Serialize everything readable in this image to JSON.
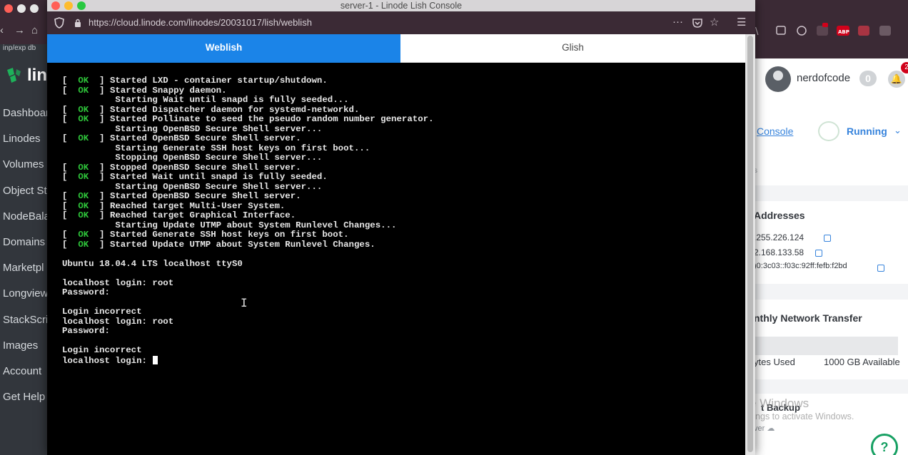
{
  "window": {
    "title": "server-1 - Linode Lish Console",
    "url": "https://cloud.linode.com/linodes/20031017/lish/weblish"
  },
  "tabs": [
    {
      "label": "Weblish",
      "active": true
    },
    {
      "label": "Glish",
      "active": false
    }
  ],
  "terminal": {
    "lines": [
      {
        "status": "OK",
        "text": "Started LXD - container startup/shutdown."
      },
      {
        "status": "OK",
        "text": "Started Snappy daemon."
      },
      {
        "status": "",
        "text": "Starting Wait until snapd is fully seeded..."
      },
      {
        "status": "OK",
        "text": "Started Dispatcher daemon for systemd-networkd."
      },
      {
        "status": "OK",
        "text": "Started Pollinate to seed the pseudo random number generator."
      },
      {
        "status": "",
        "text": "Starting OpenBSD Secure Shell server..."
      },
      {
        "status": "OK",
        "text": "Started OpenBSD Secure Shell server."
      },
      {
        "status": "",
        "text": "Starting Generate SSH host keys on first boot..."
      },
      {
        "status": "",
        "text": "Stopping OpenBSD Secure Shell server..."
      },
      {
        "status": "OK",
        "text": "Stopped OpenBSD Secure Shell server."
      },
      {
        "status": "OK",
        "text": "Started Wait until snapd is fully seeded."
      },
      {
        "status": "",
        "text": "Starting OpenBSD Secure Shell server..."
      },
      {
        "status": "OK",
        "text": "Started OpenBSD Secure Shell server."
      },
      {
        "status": "OK",
        "text": "Reached target Multi-User System."
      },
      {
        "status": "OK",
        "text": "Reached target Graphical Interface."
      },
      {
        "status": "",
        "text": "Starting Update UTMP about System Runlevel Changes..."
      },
      {
        "status": "OK",
        "text": "Started Generate SSH host keys on first boot."
      },
      {
        "status": "OK",
        "text": "Started Update UTMP about System Runlevel Changes."
      },
      {
        "plain": ""
      },
      {
        "plain": "Ubuntu 18.04.4 LTS localhost ttyS0"
      },
      {
        "plain": ""
      },
      {
        "plain": "localhost login: root"
      },
      {
        "plain": "Password:"
      },
      {
        "plain": ""
      },
      {
        "plain": "Login incorrect"
      },
      {
        "plain": "localhost login: root"
      },
      {
        "plain": "Password:"
      },
      {
        "plain": ""
      },
      {
        "plain": "Login incorrect"
      },
      {
        "plain": "localhost login: ",
        "cursor": true
      }
    ]
  },
  "background": {
    "left": {
      "path_text": "inp/exp db",
      "logo_text": "lin",
      "nav": [
        "Dashboar",
        "Linodes",
        "Volumes",
        "Object St",
        "NodeBala",
        "Domains",
        "Marketpl",
        "Longview",
        "StackScri",
        "Images",
        "Account",
        "Get Help"
      ]
    },
    "right": {
      "username": "nerdofcode",
      "badge_count": "0",
      "notification_count": "2",
      "console_link": "Console",
      "status": "Running",
      "small_text": "s",
      "addresses_title": "Addresses",
      "ips": [
        ".255.226.124",
        "2.168.133.58",
        ")0:3c03::f03c:92ff:fefb:f2bd"
      ],
      "network_title": "nthly Network Transfer",
      "network_used": "ytes Used",
      "network_available": "1000 GB Available",
      "backup_title": "t Backup",
      "backup_sub": "ver",
      "help_glyph": "?"
    }
  },
  "watermark": {
    "title": "Activate Windows",
    "subtitle": "Go to Settings to activate Windows."
  },
  "colors": {
    "accent": "#1b84e8",
    "ok_green": "#2ec53a",
    "running_blue": "#3683dc",
    "titlebar_purple": "#3b2a35"
  }
}
